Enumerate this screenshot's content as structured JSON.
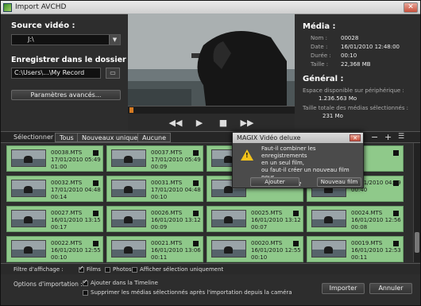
{
  "window": {
    "title": "Import AVCHD"
  },
  "source": {
    "label": "Source vidéo :",
    "drive": "J:\\"
  },
  "save": {
    "label": "Enregistrer dans le dossier suivant :",
    "path": "C:\\Users\\...\\My Record",
    "advanced_button": "Paramètres avancés..."
  },
  "media": {
    "heading": "Média :",
    "rows": [
      {
        "key": "Nom :",
        "value": "00028"
      },
      {
        "key": "Date :",
        "value": "16/01/2010 12:48:00"
      },
      {
        "key": "Durée :",
        "value": "00:10"
      },
      {
        "key": "Taille :",
        "value": "22,368 MB"
      }
    ]
  },
  "general": {
    "heading": "Général :",
    "space_label": "Espace disponible sur périphérique :",
    "space_value": "1.236.563 Mo",
    "total_label": "Taille totale des médias sélectionnés :",
    "total_value": "231 Mo"
  },
  "selection": {
    "label": "Sélectionner :",
    "buttons": [
      "Tous",
      "Nouveaux uniquement",
      "Aucune"
    ]
  },
  "clips": [
    {
      "name": "00038.MTS",
      "date": "17/01/2010 05:49",
      "dur": "01:00"
    },
    {
      "name": "00037.MTS",
      "date": "17/01/2010 05:49",
      "dur": "00:09"
    },
    {
      "name": "",
      "date": "",
      "dur": ""
    },
    {
      "name": "",
      "date": "",
      "dur": ""
    },
    {
      "name": "",
      "date": "17/01/2010 04:49",
      "dur": "00:40"
    },
    {
      "name": "00032.MTS",
      "date": "17/01/2010 04:48",
      "dur": "00:14"
    },
    {
      "name": "00031.MTS",
      "date": "17/01/2010 04:48",
      "dur": "00:10"
    },
    {
      "name": "",
      "date": "",
      "dur": ""
    },
    {
      "name": "",
      "date": "",
      "dur": ""
    },
    {
      "name": "",
      "date": "17/01/2010 04:48",
      "dur": "00:14"
    },
    {
      "name": "00027.MTS",
      "date": "16/01/2010 13:15",
      "dur": "00:17"
    },
    {
      "name": "00026.MTS",
      "date": "16/01/2010 13:12",
      "dur": "00:09"
    },
    {
      "name": "00025.MTS",
      "date": "16/01/2010 13:12",
      "dur": "00:07"
    },
    {
      "name": "00024.MTS",
      "date": "16/01/2010 12:56",
      "dur": "00:08"
    },
    {
      "name": "00023.MTS",
      "date": "16/01/2010 12:55",
      "dur": "00:09"
    },
    {
      "name": "00022.MTS",
      "date": "16/01/2010 12:55",
      "dur": "00:10"
    },
    {
      "name": "00021.MTS",
      "date": "16/01/2010 13:06",
      "dur": "00:11"
    },
    {
      "name": "00020.MTS",
      "date": "16/01/2010 12:55",
      "dur": "00:10"
    },
    {
      "name": "00019.MTS",
      "date": "16/01/2010 12:53",
      "dur": "00:11"
    }
  ],
  "filter": {
    "label": "Filtre d'affichage :",
    "films": "Films",
    "photos": "Photos",
    "selected_only": "Afficher sélection uniquement"
  },
  "import_options": {
    "label": "Options d'importation :",
    "add_timeline": "Ajouter dans la Timeline",
    "delete_after": "Supprimer les médias sélectionnés après l'importation depuis la caméra",
    "import_button": "Importer",
    "cancel_button": "Annuler"
  },
  "dialog": {
    "title": "MAGIX Vidéo deluxe",
    "line1": "Faut-il combiner les enregistrements",
    "line2": "en un seul film,",
    "line3": "ou faut-il créer un nouveau film pour",
    "line4": "chacun d'eux?",
    "ok": "Ajouter",
    "new": "Nouveau film"
  },
  "colors": {
    "tile": "#8fc98a",
    "accent": "#d57a22",
    "warning": "#f3c21b"
  }
}
